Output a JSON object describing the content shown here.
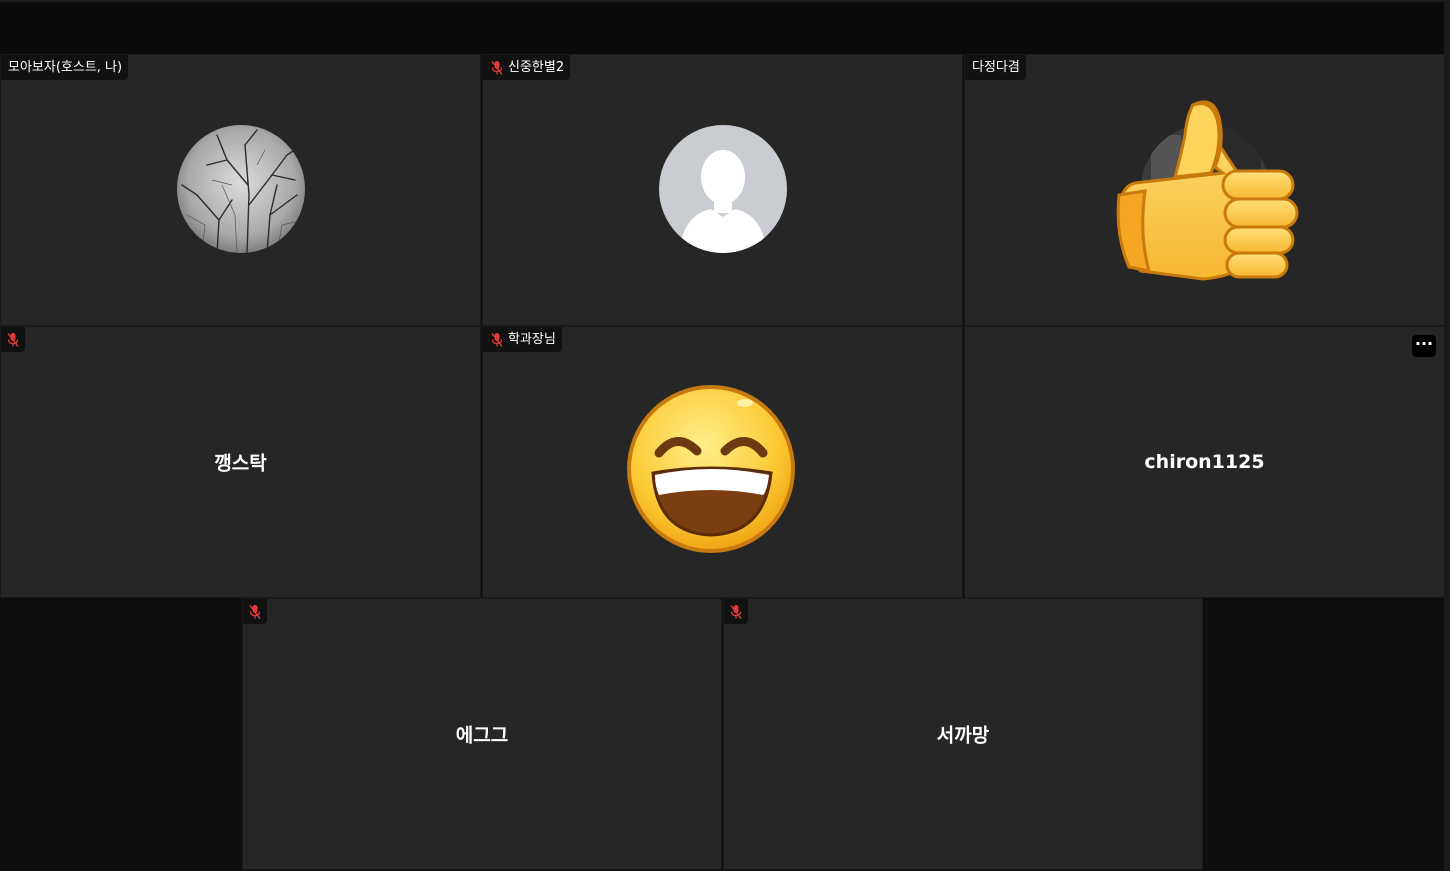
{
  "participants": [
    {
      "name": "모아보자(호스트, 나)",
      "muted": false,
      "display": "avatar-photo"
    },
    {
      "name": "신중한별2",
      "muted": true,
      "display": "avatar-default"
    },
    {
      "name": "다정다겸",
      "muted": false,
      "display": "avatar-with-reaction",
      "reaction_icon": "thumbs-up-icon"
    },
    {
      "name": "",
      "center_label": "깽스탁",
      "muted": true,
      "display": "name"
    },
    {
      "name": "학과장님",
      "muted": true,
      "display": "reaction",
      "reaction_icon": "laughing-face-icon"
    },
    {
      "name": "",
      "center_label": "chiron1125",
      "muted": false,
      "display": "name",
      "more_label": "···"
    },
    {
      "name": "",
      "center_label": "에그그",
      "muted": true,
      "display": "name"
    },
    {
      "name": "",
      "center_label": "서까망",
      "muted": true,
      "display": "name"
    }
  ],
  "colors": {
    "background": "#0e0e0e",
    "tile": "#262626",
    "nametag": "#111111",
    "mic_muted": "#e03b3b",
    "text": "#ffffff"
  }
}
